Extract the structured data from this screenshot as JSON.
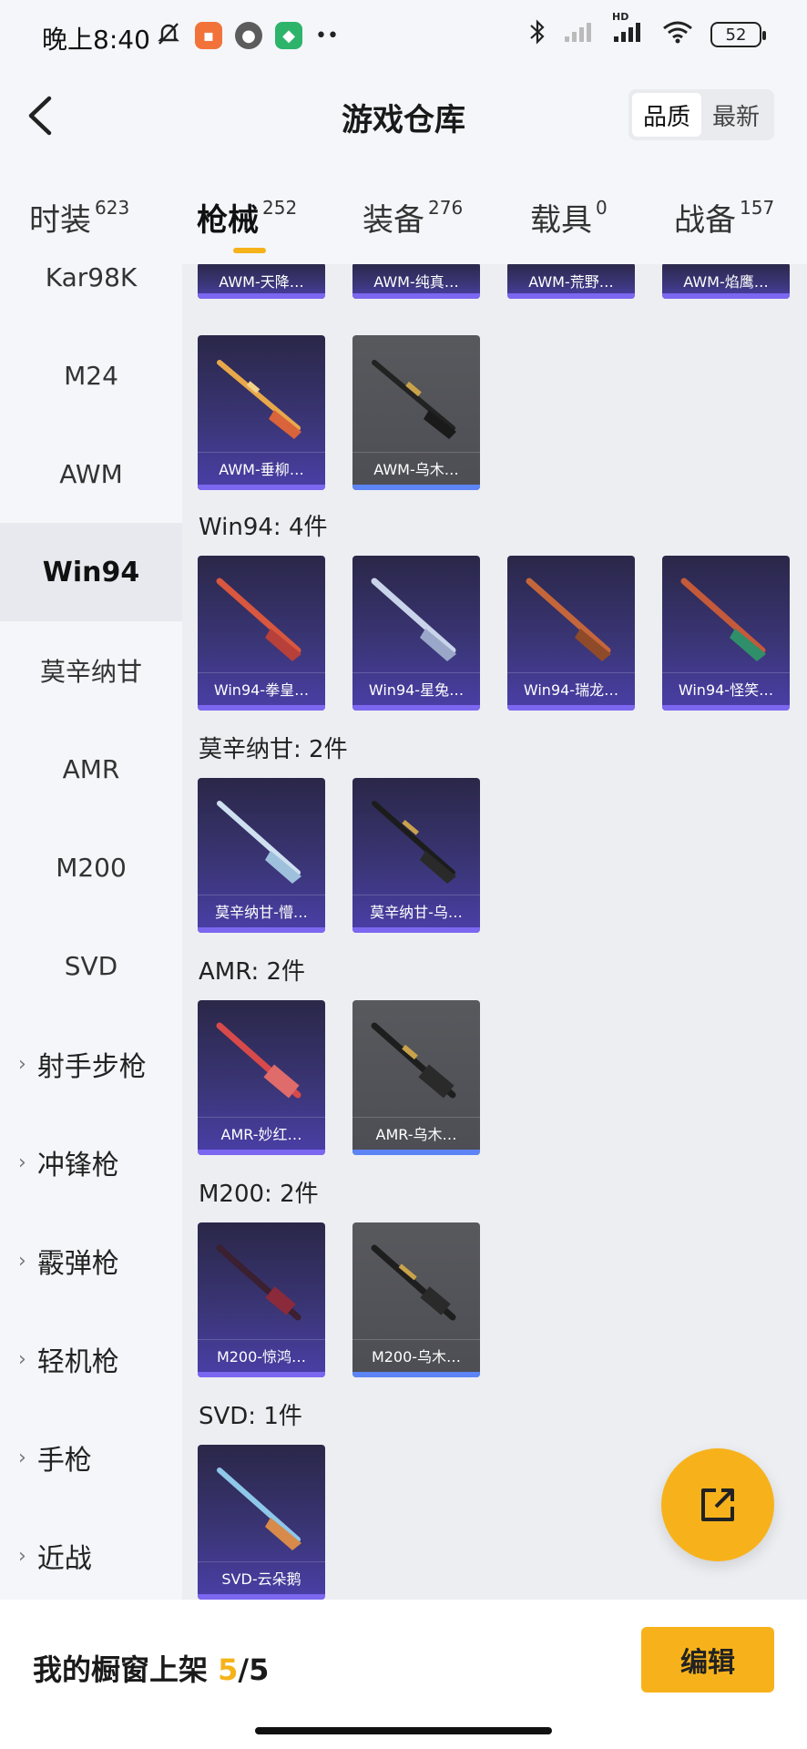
{
  "status_bar": {
    "time": "晚上8:40",
    "battery": "52",
    "network_badge": "HD",
    "icons": [
      "mute-bell-icon",
      "app-store-icon",
      "avatar-icon",
      "shield-app-icon",
      "more-dots-icon",
      "bluetooth-icon",
      "signal-icon",
      "signal-hd-icon",
      "wifi-icon",
      "battery-icon"
    ]
  },
  "header": {
    "title": "游戏仓库",
    "sort_options": [
      "品质",
      "最新"
    ],
    "active_sort": "品质"
  },
  "tabs": [
    {
      "label": "时装",
      "count": "623"
    },
    {
      "label": "枪械",
      "count": "252"
    },
    {
      "label": "装备",
      "count": "276"
    },
    {
      "label": "载具",
      "count": "0"
    },
    {
      "label": "战备",
      "count": "157"
    }
  ],
  "sidebar": {
    "items": [
      "Kar98K",
      "M24",
      "AWM",
      "Win94",
      "莫辛纳甘",
      "AMR",
      "M200",
      "SVD"
    ],
    "active": "Win94",
    "groups": [
      "射手步枪",
      "冲锋枪",
      "霰弹枪",
      "轻机枪",
      "手枪",
      "近战"
    ]
  },
  "sections": {
    "awm_top": [
      "AWM-天降…",
      "AWM-纯真…",
      "AWM-荒野…",
      "AWM-焰鹰…"
    ],
    "awm": [
      "AWM-垂柳…",
      "AWM-乌木…"
    ],
    "win94_title": "Win94: 4件",
    "win94": [
      "Win94-拳皇…",
      "Win94-星兔…",
      "Win94-瑞龙…",
      "Win94-怪笑…"
    ],
    "mosin_title": "莫辛纳甘: 2件",
    "mosin": [
      "莫辛纳甘-懵…",
      "莫辛纳甘-乌…"
    ],
    "amr_title": "AMR: 2件",
    "amr": [
      "AMR-妙红…",
      "AMR-乌木…"
    ],
    "m200_title": "M200: 2件",
    "m200": [
      "M200-惊鸿…",
      "M200-乌木…"
    ],
    "svd_title": "SVD: 1件",
    "svd": [
      "SVD-云朵鹅"
    ]
  },
  "bottom": {
    "label": "我的橱窗上架",
    "count_current": "5",
    "count_sep_total": "/5",
    "edit_label": "编辑"
  },
  "colors": {
    "accent": "#f7b21b",
    "card_purple": "#3a3575",
    "card_gray": "#55565b"
  }
}
